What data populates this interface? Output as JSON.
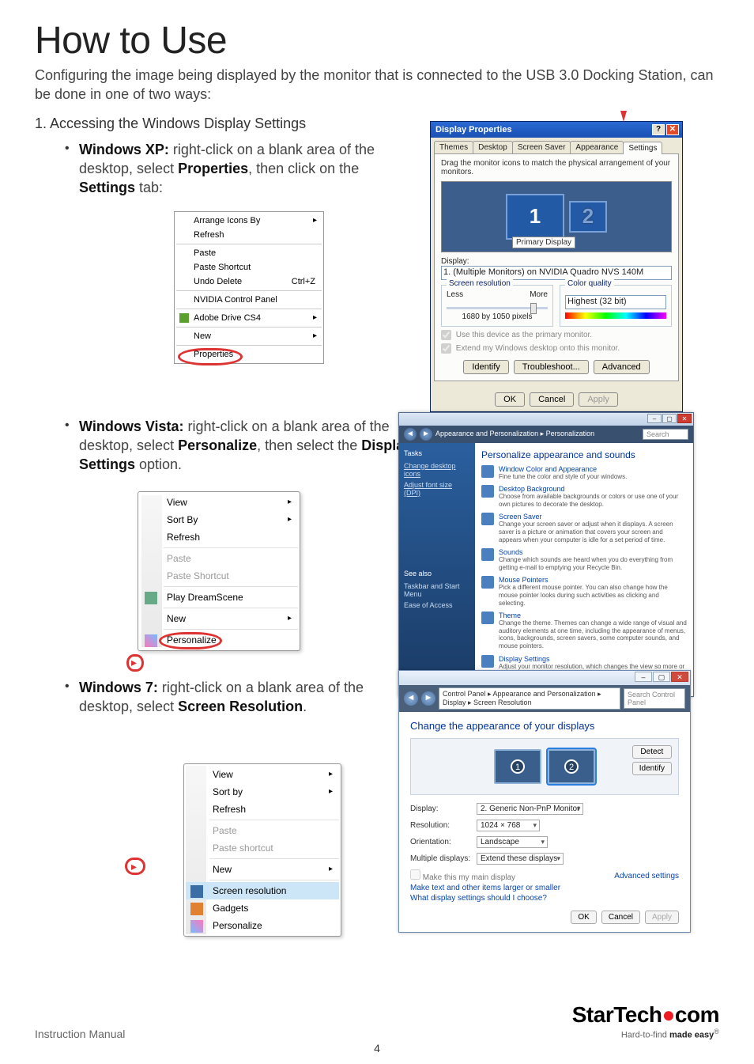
{
  "page": {
    "title": "How to Use",
    "intro": "Configuring the image being displayed by the monitor that is connected to the USB 3.0 Docking Station, can be done in one of two ways:",
    "step1": "1.  Accessing the Windows Display Settings",
    "footer_label": "Instruction Manual",
    "page_number": "4"
  },
  "xp": {
    "bullet_prefix": "Windows XP:",
    "bullet_text": " right-click on a blank area of the desktop, select ",
    "bullet_bold1": "Properties",
    "bullet_mid": ", then click on the ",
    "bullet_bold2": "Settings",
    "bullet_suffix": " tab:",
    "menu": {
      "arrange": "Arrange Icons By",
      "refresh": "Refresh",
      "paste": "Paste",
      "paste_shortcut": "Paste Shortcut",
      "undo": "Undo Delete",
      "undo_key": "Ctrl+Z",
      "nvidia": "NVIDIA Control Panel",
      "adobe": "Adobe Drive CS4",
      "new": "New",
      "properties": "Properties"
    },
    "dp": {
      "title": "Display Properties",
      "tabs": [
        "Themes",
        "Desktop",
        "Screen Saver",
        "Appearance",
        "Settings"
      ],
      "drag_text": "Drag the monitor icons to match the physical arrangement of your monitors.",
      "mon1": "1",
      "mon2": "2",
      "primary_badge": "Primary Display",
      "display_label": "Display:",
      "display_value": "1. (Multiple Monitors) on NVIDIA Quadro NVS 140M",
      "screen_res": "Screen resolution",
      "less": "Less",
      "more": "More",
      "res_value": "1680 by 1050 pixels",
      "color_quality": "Color quality",
      "color_value": "Highest (32 bit)",
      "chk1": "Use this device as the primary monitor.",
      "chk2": "Extend my Windows desktop onto this monitor.",
      "btn_identify": "Identify",
      "btn_trouble": "Troubleshoot...",
      "btn_adv": "Advanced",
      "btn_ok": "OK",
      "btn_cancel": "Cancel",
      "btn_apply": "Apply"
    }
  },
  "vista": {
    "bullet_prefix": "Windows Vista:",
    "bullet_text": " right-click on a blank area of the desktop, select ",
    "bullet_bold1": "Personalize",
    "bullet_mid": ", then select the ",
    "bullet_bold2": "Display Settings",
    "bullet_suffix": " option.",
    "menu": {
      "view": "View",
      "sort": "Sort By",
      "refresh": "Refresh",
      "paste": "Paste",
      "paste_shortcut": "Paste Shortcut",
      "dreamscene": "Play DreamScene",
      "new": "New",
      "personalize": "Personalize"
    },
    "win": {
      "path": "Appearance and Personalization  ▸  Personalization",
      "search": "Search",
      "side_tasks": "Tasks",
      "side_change": "Change desktop icons",
      "side_font": "Adjust font size (DPI)",
      "side_seealso": "See also",
      "side_taskbar": "Taskbar and Start Menu",
      "side_ease": "Ease of Access",
      "heading": "Personalize appearance and sounds",
      "items": [
        {
          "t": "Window Color and Appearance",
          "d": "Fine tune the color and style of your windows."
        },
        {
          "t": "Desktop Background",
          "d": "Choose from available backgrounds or colors or use one of your own pictures to decorate the desktop."
        },
        {
          "t": "Screen Saver",
          "d": "Change your screen saver or adjust when it displays. A screen saver is a picture or animation that covers your screen and appears when your computer is idle for a set period of time."
        },
        {
          "t": "Sounds",
          "d": "Change which sounds are heard when you do everything from getting e-mail to emptying your Recycle Bin."
        },
        {
          "t": "Mouse Pointers",
          "d": "Pick a different mouse pointer. You can also change how the mouse pointer looks during such activities as clicking and selecting."
        },
        {
          "t": "Theme",
          "d": "Change the theme. Themes can change a wide range of visual and auditory elements at one time, including the appearance of menus, icons, backgrounds, screen savers, some computer sounds, and mouse pointers."
        },
        {
          "t": "Display Settings",
          "d": "Adjust your monitor resolution, which changes the view so more or fewer items fit on the screen. You can also control monitor flicker (refresh rate)."
        }
      ]
    }
  },
  "w7": {
    "bullet_prefix": "Windows 7:",
    "bullet_text": " right-click on a blank area of the desktop, select ",
    "bullet_bold1": "Screen Resolution",
    "bullet_suffix": ".",
    "menu": {
      "view": "View",
      "sort": "Sort by",
      "refresh": "Refresh",
      "paste": "Paste",
      "paste_shortcut": "Paste shortcut",
      "new": "New",
      "screenres": "Screen resolution",
      "gadgets": "Gadgets",
      "personalize": "Personalize"
    },
    "win": {
      "path": "Control Panel  ▸  Appearance and Personalization  ▸  Display  ▸  Screen Resolution",
      "search": "Search Control Panel",
      "heading": "Change the appearance of your displays",
      "btn_detect": "Detect",
      "btn_identify": "Identify",
      "lbl_display": "Display:",
      "val_display": "2. Generic Non-PnP Monitor",
      "lbl_res": "Resolution:",
      "val_res": "1024 × 768",
      "lbl_orient": "Orientation:",
      "val_orient": "Landscape",
      "lbl_multi": "Multiple displays:",
      "val_multi": "Extend these displays",
      "chk_main": "Make this my main display",
      "link_adv": "Advanced settings",
      "link_text": "Make text and other items larger or smaller",
      "link_what": "What display settings should I choose?",
      "btn_ok": "OK",
      "btn_cancel": "Cancel",
      "btn_apply": "Apply"
    }
  },
  "logo": {
    "name_a": "StarTech",
    "name_b": "com",
    "tag_a": "Hard-to-find ",
    "tag_b": "made easy"
  }
}
